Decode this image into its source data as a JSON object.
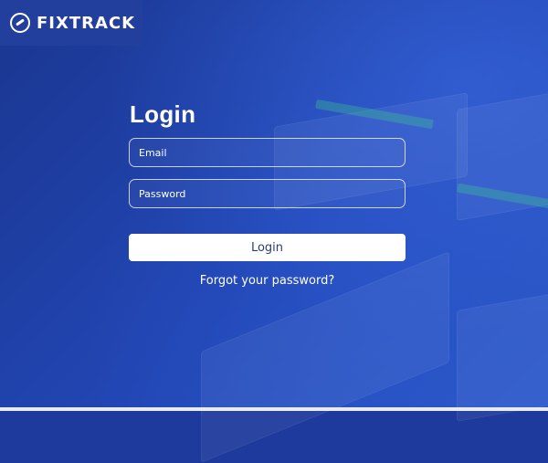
{
  "brand": {
    "name": "FIXTRACK",
    "logo_icon": "wrench-circle-icon"
  },
  "login": {
    "title": "Login",
    "email_label": "Email",
    "password_label": "Password",
    "submit_label": "Login",
    "forgot_label": "Forgot your password?"
  },
  "colors": {
    "background": "#1d3a9c",
    "logo_box": "#223f9e",
    "button_bg": "#ffffff",
    "button_text": "#2b3d74"
  }
}
